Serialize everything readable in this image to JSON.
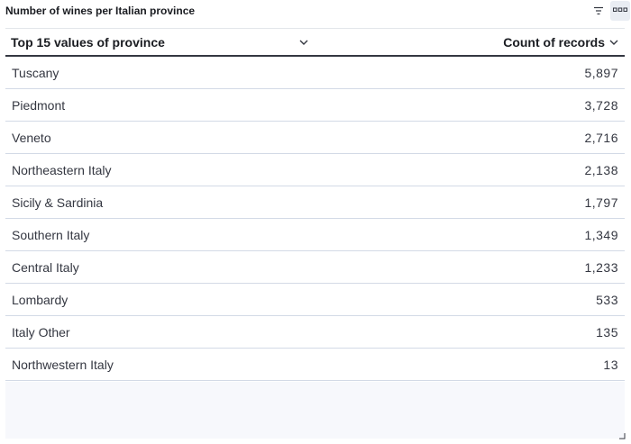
{
  "panel": {
    "title": "Number of wines per Italian province",
    "filter_icon": "filter-icon",
    "options_icon": "options-menu-icon"
  },
  "table": {
    "headers": {
      "province": "Top 15 values of province",
      "count": "Count of records"
    },
    "rows": [
      {
        "province": "Tuscany",
        "count": "5,897"
      },
      {
        "province": "Piedmont",
        "count": "3,728"
      },
      {
        "province": "Veneto",
        "count": "2,716"
      },
      {
        "province": "Northeastern Italy",
        "count": "2,138"
      },
      {
        "province": "Sicily & Sardinia",
        "count": "1,797"
      },
      {
        "province": "Southern Italy",
        "count": "1,349"
      },
      {
        "province": "Central Italy",
        "count": "1,233"
      },
      {
        "province": "Lombardy",
        "count": "533"
      },
      {
        "province": "Italy Other",
        "count": "135"
      },
      {
        "province": "Northwestern Italy",
        "count": "13"
      }
    ]
  },
  "colors": {
    "header_border": "#343741",
    "row_border": "#d3dae6",
    "text": "#343741",
    "options_button_bg": "#e9edf3"
  }
}
